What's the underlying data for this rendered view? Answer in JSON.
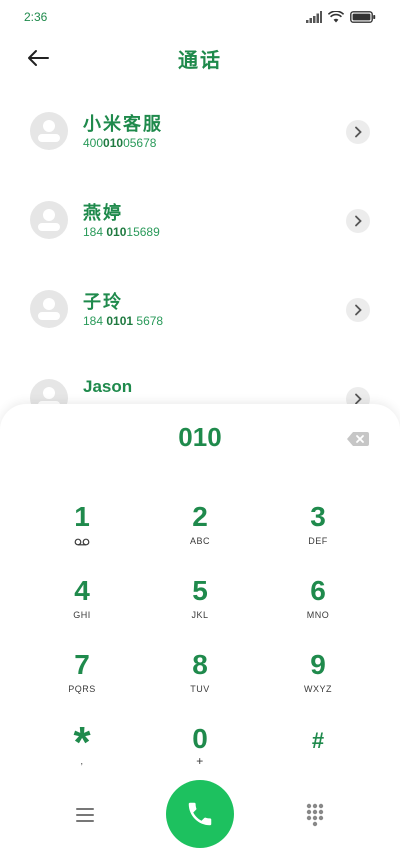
{
  "status_bar": {
    "time": "2:36",
    "icons": [
      "signal-icon",
      "wifi-icon",
      "battery-icon"
    ]
  },
  "header": {
    "title": "通话",
    "back_icon": "arrow-left-icon"
  },
  "contacts": [
    {
      "name": "小米客服",
      "number_parts": [
        "400",
        "010",
        "05678"
      ]
    },
    {
      "name": "燕婷",
      "number_parts": [
        "184 ",
        "010",
        "15689"
      ]
    },
    {
      "name": "子玲",
      "number_parts": [
        "184 ",
        "0101",
        " 5678"
      ]
    },
    {
      "name": "Jason",
      "number_parts": [
        "",
        "",
        ""
      ]
    }
  ],
  "dialer": {
    "input_value": "010",
    "keys": [
      {
        "digit": "1",
        "letters": ""
      },
      {
        "digit": "2",
        "letters": "ABC"
      },
      {
        "digit": "3",
        "letters": "DEF"
      },
      {
        "digit": "4",
        "letters": "GHI"
      },
      {
        "digit": "5",
        "letters": "JKL"
      },
      {
        "digit": "6",
        "letters": "MNO"
      },
      {
        "digit": "7",
        "letters": "PQRS"
      },
      {
        "digit": "8",
        "letters": "TUV"
      },
      {
        "digit": "9",
        "letters": "WXYZ"
      },
      {
        "digit": "*",
        "letters": ","
      },
      {
        "digit": "0",
        "letters": "+"
      },
      {
        "digit": "#",
        "letters": ""
      }
    ]
  },
  "colors": {
    "accent": "#1f8a4c",
    "call_button": "#1dc15f",
    "avatar_bg": "#e6e6e6"
  }
}
